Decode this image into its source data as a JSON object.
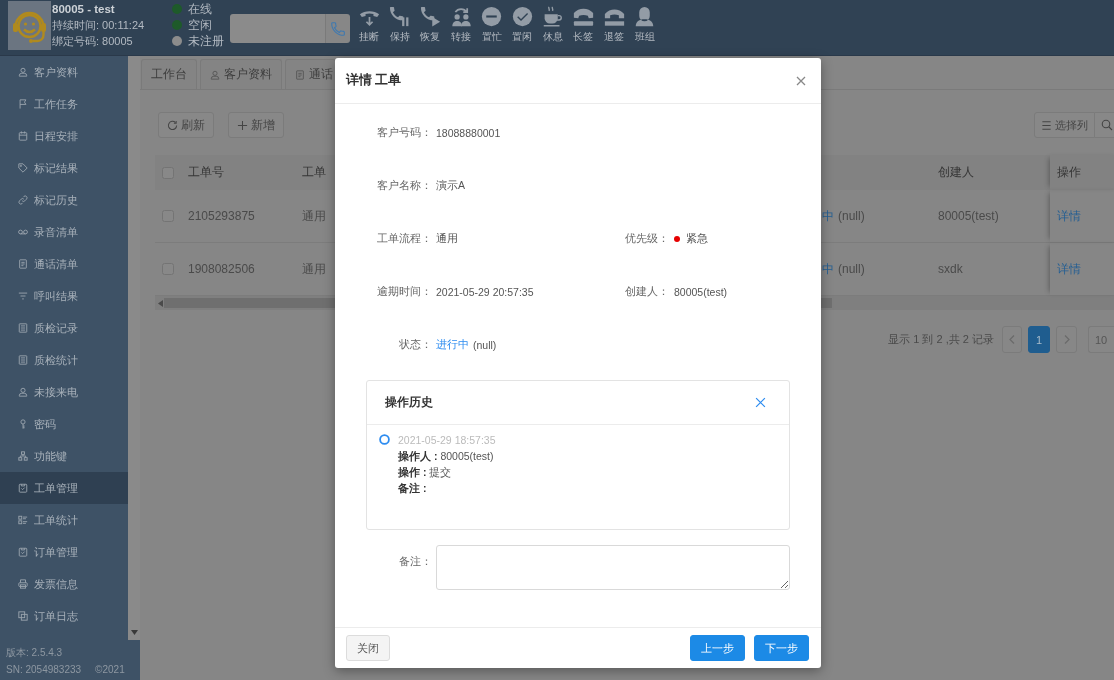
{
  "agent": {
    "name": "80005 - test",
    "duration": "持续时间: 00:11:24",
    "bound_number": "绑定号码: 80005"
  },
  "statuses": [
    {
      "label": "在线",
      "color": "#1e5a2a"
    },
    {
      "label": "空闲",
      "color": "#1e5a2a"
    },
    {
      "label": "未注册",
      "color": "#8c8c8c"
    }
  ],
  "call_actions": [
    {
      "label": "挂断",
      "kind": "hangup"
    },
    {
      "label": "保持",
      "kind": "hold"
    },
    {
      "label": "恢复",
      "kind": "resume"
    },
    {
      "label": "转接",
      "kind": "transfer"
    },
    {
      "label": "置忙",
      "kind": "busy"
    },
    {
      "label": "置闲",
      "kind": "idle"
    },
    {
      "label": "休息",
      "kind": "rest"
    },
    {
      "label": "长签",
      "kind": "sign_in"
    },
    {
      "label": "退签",
      "kind": "sign_out"
    },
    {
      "label": "班组",
      "kind": "team"
    }
  ],
  "sidebar": {
    "items": [
      {
        "label": "客户资料",
        "kind": "person",
        "selected": false
      },
      {
        "label": "工作任务",
        "kind": "flag",
        "selected": false
      },
      {
        "label": "日程安排",
        "kind": "calendar",
        "selected": false
      },
      {
        "label": "标记结果",
        "kind": "tag",
        "selected": false
      },
      {
        "label": "标记历史",
        "kind": "link",
        "selected": false
      },
      {
        "label": "录音清单",
        "kind": "voicemail",
        "selected": false
      },
      {
        "label": "通话清单",
        "kind": "doc",
        "selected": false
      },
      {
        "label": "呼叫结果",
        "kind": "filter",
        "selected": false
      },
      {
        "label": "质检记录",
        "kind": "report",
        "selected": false
      },
      {
        "label": "质检统计",
        "kind": "report",
        "selected": false
      },
      {
        "label": "未接来电",
        "kind": "person",
        "selected": false
      },
      {
        "label": "密码",
        "kind": "key",
        "selected": false
      },
      {
        "label": "功能键",
        "kind": "sitemap",
        "selected": false
      },
      {
        "label": "工单管理",
        "kind": "clipboard",
        "selected": true
      },
      {
        "label": "工单统计",
        "kind": "checklist",
        "selected": false
      },
      {
        "label": "订单管理",
        "kind": "clipboard",
        "selected": false
      },
      {
        "label": "发票信息",
        "kind": "printer",
        "selected": false
      },
      {
        "label": "订单日志",
        "kind": "copy",
        "selected": false
      }
    ],
    "version": "版本: 2.5.4.3",
    "serial": "SN: 2054983233",
    "copyright": "©2021"
  },
  "tabs": [
    {
      "label": "工作台",
      "kind": "plain",
      "selected": false
    },
    {
      "label": "客户资料",
      "kind": "person",
      "selected": false
    },
    {
      "label": "通话",
      "kind": "doc",
      "selected": false
    }
  ],
  "toolbar": {
    "actions": [
      {
        "label": "刷新",
        "kind": "refresh"
      },
      {
        "label": "新增",
        "kind": "add"
      }
    ],
    "tools": [
      {
        "label": "选择列",
        "kind": "columns"
      },
      {
        "kind": "search"
      }
    ]
  },
  "table": {
    "header_checked": false,
    "columns": [
      {
        "label": "工单号",
        "kind": "number"
      },
      {
        "label": "工单",
        "kind": "flow"
      },
      {
        "label": "创建人",
        "kind": "creator"
      },
      {
        "label": "操作",
        "kind": "action"
      }
    ],
    "rows": [
      {
        "checked": false,
        "number": "2105293875",
        "flow": "通用",
        "status": "中",
        "status_note": "(null)",
        "creator": "80005(test)",
        "action": "详情"
      },
      {
        "checked": false,
        "number": "1908082506",
        "flow": "通用",
        "status": "中",
        "status_note": "(null)",
        "creator": "sxdk",
        "action": "详情"
      }
    ]
  },
  "pagination": {
    "summary": "显示 1 到 2 ,共 2 记录",
    "pages": [
      {
        "label": "1",
        "selected": true
      }
    ],
    "page_size": "10"
  },
  "dialog": {
    "title": "详情 工单",
    "field_rows": [
      [
        {
          "label": "客户号码：",
          "value": "18088880001",
          "kind": "text"
        }
      ],
      [
        {
          "label": "客户名称：",
          "value": "演示A",
          "kind": "text"
        }
      ],
      [
        {
          "label": "工单流程：",
          "value": "通用",
          "kind": "text"
        },
        {
          "label": "优先级：",
          "value": "紧急",
          "kind": "priority",
          "color": "#e60000"
        }
      ],
      [
        {
          "label": "逾期时间：",
          "value": "2021-05-29 20:57:35",
          "kind": "text"
        },
        {
          "label": "创建人：",
          "value": "80005(test)",
          "kind": "text"
        }
      ],
      [
        {
          "label": "状态：",
          "value": "进行中",
          "note": "(null)",
          "kind": "status"
        }
      ]
    ],
    "history": {
      "title": "操作历史",
      "entries": [
        {
          "time": "2021-05-29 18:57:35",
          "details": [
            {
              "label": "操作人 :",
              "value": "80005(test)"
            },
            {
              "label": "操作 :",
              "value": "提交"
            },
            {
              "label": "备注 :"
            }
          ]
        }
      ]
    },
    "remark": {
      "label": "备注："
    },
    "buttons": [
      {
        "label": "关闭",
        "kind": "default"
      },
      {
        "label": "上一步",
        "kind": "primary"
      },
      {
        "label": "下一步",
        "kind": "primary"
      }
    ]
  }
}
